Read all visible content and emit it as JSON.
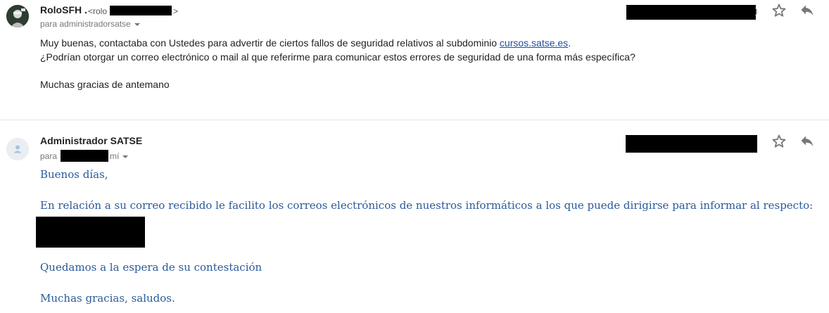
{
  "messages": [
    {
      "sender": "RoloSFH .",
      "sender_email_prefix": "<rolo",
      "sender_email_suffix": ">",
      "date_suffix": ")",
      "recipient": "para administradorsatse",
      "body": {
        "line1_text": "Muy buenas, contactaba con Ustedes para advertir de ciertos fallos de seguridad relativos al subdominio ",
        "line1_link": "cursos.satse.es",
        "line1_end": ".",
        "line2": "¿Podrían otorgar un correo electrónico o mail al que referirme para comunicar estos errores de seguridad de una forma más específica?",
        "line3": "Muchas gracias de antemano"
      },
      "actions": {
        "star_icon": "star-outline-icon",
        "reply_icon": "reply-icon"
      }
    },
    {
      "sender": "Administrador SATSE",
      "recipient_prefix": "para",
      "recipient_suffix": "mí",
      "body": {
        "greeting": "Buenos días,",
        "line1": "En relación a su correo recibido le facilito los correos electrónicos de nuestros informáticos a los que puede dirigirse para informar al respecto:",
        "line2": "Quedamos a la espera de su contestación",
        "closing": "Muchas gracias, saludos."
      },
      "actions": {
        "star_icon": "star-outline-icon",
        "reply_icon": "reply-icon"
      }
    }
  ],
  "colors": {
    "link": "#1a4fa0",
    "admin_body_text": "#2a5a9a",
    "icon": "#777777",
    "redaction": "#000000"
  }
}
